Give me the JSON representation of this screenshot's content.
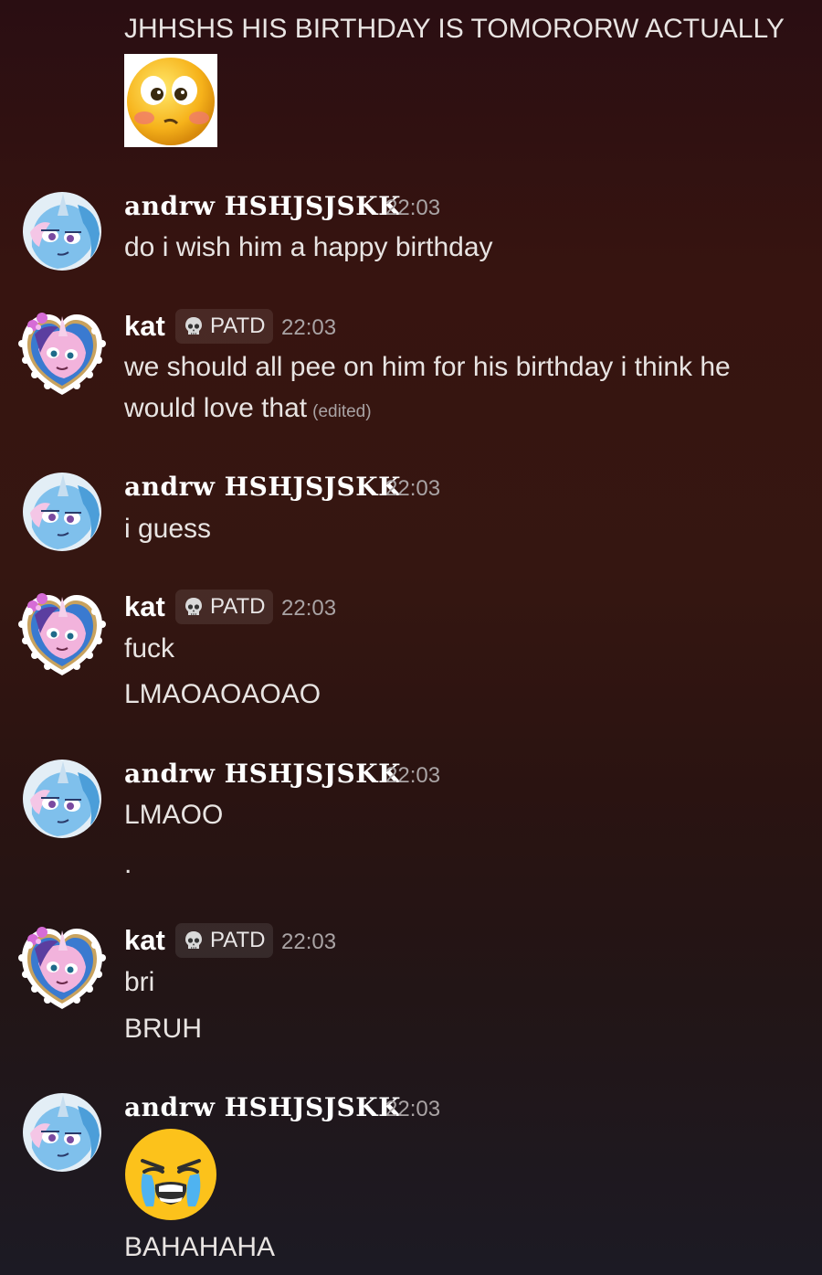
{
  "top_message": {
    "text": "JHHSHS HIS BIRTHDAY IS TOMORORW ACTUALLY",
    "emoji": "flushed-face-emoji"
  },
  "users": {
    "andrw": {
      "name": "andrw HSHJSJSKK",
      "avatar": "blue-unicorn-pony-avatar"
    },
    "kat": {
      "name": "kat",
      "tag": "PATD",
      "tag_icon": "skull-icon",
      "avatar": "pink-unicorn-pony-heart-frame-avatar"
    }
  },
  "messages": [
    {
      "author": "andrw HSHJSJSKK",
      "time": "22:03",
      "lines": [
        "do i wish him a happy birthday"
      ]
    },
    {
      "author": "kat",
      "tag": "PATD",
      "time": "22:03",
      "lines": [
        "we should all pee on him for his birthday i think he",
        "would love that"
      ],
      "edited": "(edited)"
    },
    {
      "author": "andrw HSHJSJSKK",
      "time": "22:03",
      "lines": [
        "i guess"
      ]
    },
    {
      "author": "kat",
      "tag": "PATD",
      "time": "22:03",
      "lines": [
        "fuck",
        "LMAOAOAOAO"
      ]
    },
    {
      "author": "andrw HSHJSJSKK",
      "time": "22:03",
      "lines": [
        "LMAOO",
        "."
      ]
    },
    {
      "author": "kat",
      "tag": "PATD",
      "time": "22:03",
      "lines": [
        "bri",
        "BRUH"
      ]
    },
    {
      "author": "andrw HSHJSJSKK",
      "time": "22:03",
      "emoji": "loudly-crying-face-emoji",
      "lines": [
        "BAHAHAHA"
      ]
    }
  ],
  "colors": {
    "background_top": "#2a0e12",
    "background_bottom": "#1c1a24",
    "username": "#ffffff",
    "timestamp": "#a9a3a4",
    "tag_background": "#3a2a28"
  }
}
